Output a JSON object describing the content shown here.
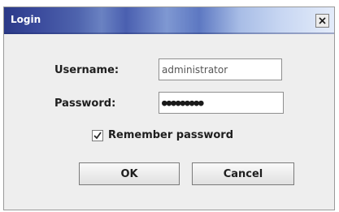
{
  "window": {
    "title": "Login",
    "close_icon": "close-icon"
  },
  "form": {
    "username_label": "Username:",
    "username_value": "administrator",
    "password_label": "Password:",
    "password_value": "●●●●●●●●●",
    "remember_label": "Remember password",
    "remember_checked": true
  },
  "buttons": {
    "ok_label": "OK",
    "cancel_label": "Cancel"
  }
}
